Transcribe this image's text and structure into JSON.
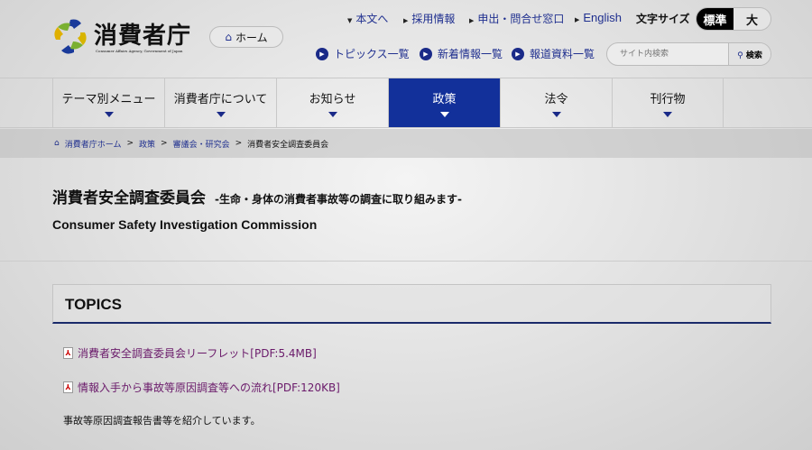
{
  "header": {
    "logo_title": "消費者庁",
    "logo_subtitle": "Consumer Affairs Agency, Government of Japan",
    "home_label": "ホーム",
    "util_links": [
      "本文へ",
      "採用情報",
      "申出・問合せ窓口",
      "English"
    ],
    "font_size_label": "文字サイズ",
    "font_size_options": [
      "標準",
      "大"
    ],
    "sub_links": [
      "トピックス一覧",
      "新着情報一覧",
      "報道資料一覧"
    ],
    "search_placeholder": "サイト内検索",
    "search_button": "検索"
  },
  "nav": [
    "テーマ別メニュー",
    "消費者庁について",
    "お知らせ",
    "政策",
    "法令",
    "刊行物"
  ],
  "breadcrumb": [
    "消費者庁ホーム",
    "政策",
    "審議会・研究会",
    "消費者安全調査委員会"
  ],
  "page": {
    "title": "消費者安全調査委員会",
    "subtitle": "-生命・身体の消費者事故等の調査に取り組みます-",
    "english_title": "Consumer Safety Investigation Commission",
    "topics_heading": "TOPICS",
    "links": [
      "消費者安全調査委員会リーフレット[PDF:5.4MB]",
      "情報入手から事故等原因調査等への流れ[PDF:120KB]"
    ],
    "note": "事故等原因調査報告書等を紹介しています。"
  },
  "colors": {
    "accent": "#12309a",
    "link": "#1f2f8f",
    "visited": "#6a1a6a"
  }
}
